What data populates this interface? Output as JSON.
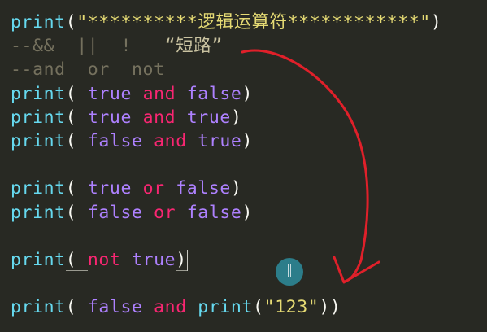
{
  "editor": {
    "lines": [
      {
        "tokens": [
          {
            "t": "print",
            "c": "tok-fn"
          },
          {
            "t": "(",
            "c": "tok-punc"
          },
          {
            "t": "\"**********逻辑运算符************\"",
            "c": "tok-str"
          },
          {
            "t": ")",
            "c": "tok-punc"
          }
        ]
      },
      {
        "tokens": [
          {
            "t": "--&&  ||  !   ",
            "c": "tok-cmt"
          },
          {
            "t": "“短路”",
            "c": "tok-cmt-str"
          }
        ]
      },
      {
        "tokens": [
          {
            "t": "--and  or  not",
            "c": "tok-cmt"
          }
        ]
      },
      {
        "tokens": [
          {
            "t": "print",
            "c": "tok-fn"
          },
          {
            "t": "( ",
            "c": "tok-punc"
          },
          {
            "t": "true",
            "c": "tok-bool"
          },
          {
            "t": " ",
            "c": "tok-punc"
          },
          {
            "t": "and",
            "c": "tok-kw"
          },
          {
            "t": " ",
            "c": "tok-punc"
          },
          {
            "t": "false",
            "c": "tok-bool"
          },
          {
            "t": ")",
            "c": "tok-punc"
          }
        ]
      },
      {
        "tokens": [
          {
            "t": "print",
            "c": "tok-fn"
          },
          {
            "t": "( ",
            "c": "tok-punc"
          },
          {
            "t": "true",
            "c": "tok-bool"
          },
          {
            "t": " ",
            "c": "tok-punc"
          },
          {
            "t": "and",
            "c": "tok-kw"
          },
          {
            "t": " ",
            "c": "tok-punc"
          },
          {
            "t": "true",
            "c": "tok-bool"
          },
          {
            "t": ")",
            "c": "tok-punc"
          }
        ]
      },
      {
        "tokens": [
          {
            "t": "print",
            "c": "tok-fn"
          },
          {
            "t": "( ",
            "c": "tok-punc"
          },
          {
            "t": "false",
            "c": "tok-bool"
          },
          {
            "t": " ",
            "c": "tok-punc"
          },
          {
            "t": "and",
            "c": "tok-kw"
          },
          {
            "t": " ",
            "c": "tok-punc"
          },
          {
            "t": "true",
            "c": "tok-bool"
          },
          {
            "t": ")",
            "c": "tok-punc"
          }
        ]
      },
      {
        "tokens": []
      },
      {
        "tokens": [
          {
            "t": "print",
            "c": "tok-fn"
          },
          {
            "t": "( ",
            "c": "tok-punc"
          },
          {
            "t": "true",
            "c": "tok-bool"
          },
          {
            "t": " ",
            "c": "tok-punc"
          },
          {
            "t": "or",
            "c": "tok-kw"
          },
          {
            "t": " ",
            "c": "tok-punc"
          },
          {
            "t": "false",
            "c": "tok-bool"
          },
          {
            "t": ")",
            "c": "tok-punc"
          }
        ]
      },
      {
        "tokens": [
          {
            "t": "print",
            "c": "tok-fn"
          },
          {
            "t": "( ",
            "c": "tok-punc"
          },
          {
            "t": "false",
            "c": "tok-bool"
          },
          {
            "t": " ",
            "c": "tok-punc"
          },
          {
            "t": "or",
            "c": "tok-kw"
          },
          {
            "t": " ",
            "c": "tok-punc"
          },
          {
            "t": "false",
            "c": "tok-bool"
          },
          {
            "t": ")",
            "c": "tok-punc"
          }
        ]
      },
      {
        "tokens": []
      },
      {
        "tokens": [
          {
            "t": "print",
            "c": "tok-fn"
          },
          {
            "t": "( ",
            "c": "tok-punc underline-mark"
          },
          {
            "t": "not",
            "c": "tok-kw"
          },
          {
            "t": " ",
            "c": "tok-punc"
          },
          {
            "t": "true",
            "c": "tok-bool"
          },
          {
            "t": ")",
            "c": "tok-punc underline-mark"
          }
        ]
      },
      {
        "tokens": []
      },
      {
        "tokens": [
          {
            "t": "print",
            "c": "tok-fn"
          },
          {
            "t": "( ",
            "c": "tok-punc"
          },
          {
            "t": "false",
            "c": "tok-bool"
          },
          {
            "t": " ",
            "c": "tok-punc"
          },
          {
            "t": "and",
            "c": "tok-kw"
          },
          {
            "t": " ",
            "c": "tok-punc"
          },
          {
            "t": "print",
            "c": "tok-fn"
          },
          {
            "t": "(",
            "c": "tok-punc"
          },
          {
            "t": "\"123\"",
            "c": "tok-str"
          },
          {
            "t": "))",
            "c": "tok-punc"
          }
        ]
      }
    ]
  },
  "colors": {
    "background": "#282923",
    "function": "#66d9ef",
    "string": "#e6db74",
    "boolean": "#ae81ff",
    "keyword": "#f92672",
    "comment": "#75715e",
    "annotation_red": "#e0202a",
    "click_marker": "#2d8c9c"
  },
  "icons": {
    "click_marker": "text-cursor-ibeam-icon",
    "annotation": "red-curved-arrow-icon"
  }
}
